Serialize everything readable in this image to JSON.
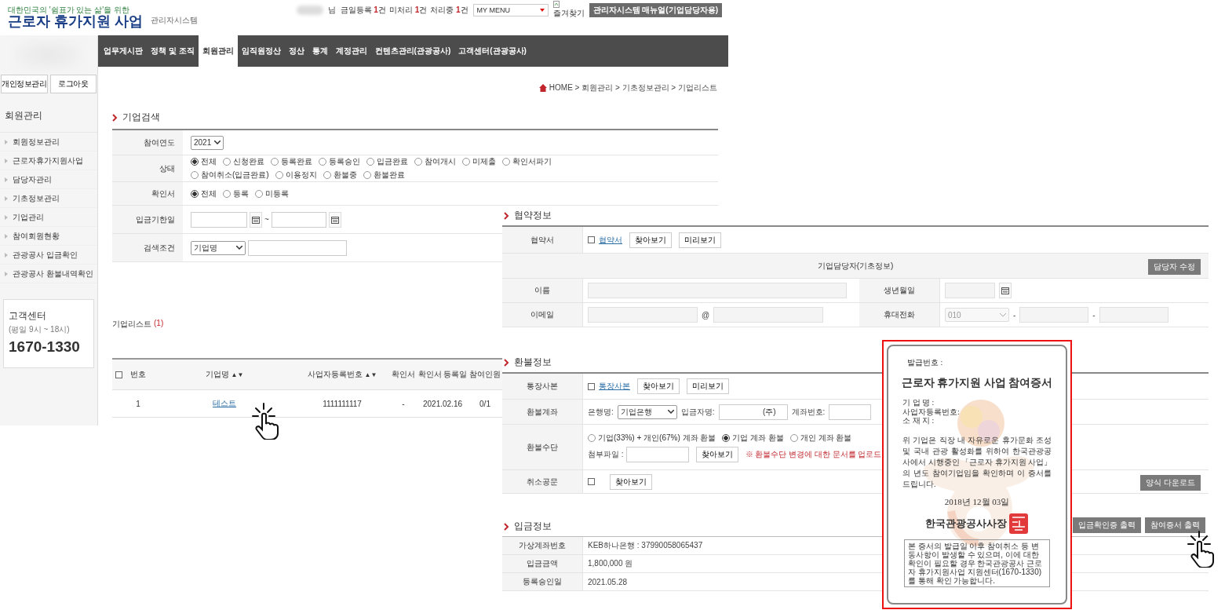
{
  "header": {
    "logo_tagline": "대한민국의 '쉼표가 있는 삶'을 위한",
    "logo_title": "근로자 휴가지원 사업",
    "system_label": "관리자시스템",
    "user_suffix": "님",
    "counts": [
      {
        "label": "금일등록",
        "count": "1",
        "unit": "건"
      },
      {
        "label": "미처리",
        "count": "1",
        "unit": "건"
      },
      {
        "label": "처리중",
        "count": "1",
        "unit": "건"
      }
    ],
    "my_menu": "MY MENU",
    "favorites": "즐겨찾기",
    "manual_button": "관리자시스템 매뉴얼(기업담당자용)"
  },
  "nav": [
    {
      "label": "업무게시판",
      "selected": false
    },
    {
      "label": "정책 및 조직",
      "selected": false
    },
    {
      "label": "회원관리",
      "selected": true
    },
    {
      "label": "임직원정산",
      "selected": false
    },
    {
      "label": "정산",
      "selected": false
    },
    {
      "label": "통계",
      "selected": false
    },
    {
      "label": "계정관리",
      "selected": false
    },
    {
      "label": "컨텐츠관리(관광공사)",
      "selected": false
    },
    {
      "label": "고객센터(관광공사)",
      "selected": false
    }
  ],
  "sidebar": {
    "buttons": [
      "개인정보관리",
      "로그아웃"
    ],
    "title": "회원관리",
    "items": [
      "회원정보관리",
      "근로자휴가지원사업",
      "담당자관리",
      "기초정보관리",
      "기업관리",
      "참여회원현황",
      "관광공사 입금확인",
      "관광공사 환불내역확인"
    ],
    "help": {
      "title": "고객센터",
      "hours": "(평일 9시 ~ 18시)",
      "phone": "1670-1330"
    }
  },
  "breadcrumb": "HOME > 회원관리 > 기초정보관리 > 기업리스트",
  "search": {
    "title": "기업검색",
    "year": {
      "label": "참여연도",
      "value": "2021"
    },
    "status": {
      "label": "상태",
      "options": [
        {
          "label": "전체",
          "selected": true
        },
        {
          "label": "신청완료",
          "selected": false
        },
        {
          "label": "등록완료",
          "selected": false
        },
        {
          "label": "등록승인",
          "selected": false
        },
        {
          "label": "입금완료",
          "selected": false
        },
        {
          "label": "참여개시",
          "selected": false
        },
        {
          "label": "미제출",
          "selected": false
        },
        {
          "label": "확인서파기",
          "selected": false
        },
        {
          "label": "참여취소(입금완료)",
          "selected": false
        },
        {
          "label": "이용정지",
          "selected": false
        },
        {
          "label": "환불중",
          "selected": false
        },
        {
          "label": "환불완료",
          "selected": false
        }
      ]
    },
    "confirm": {
      "label": "확인서",
      "options": [
        {
          "label": "전체",
          "selected": true
        },
        {
          "label": "등록",
          "selected": false
        },
        {
          "label": "미등록",
          "selected": false
        }
      ]
    },
    "deadline": {
      "label": "입금기한일",
      "separator": "~"
    },
    "condition": {
      "label": "검색조건",
      "value": "기업명"
    }
  },
  "company_list": {
    "title": "기업리스트",
    "count": "(1)",
    "header_checked": false,
    "columns": [
      {
        "label": "번호"
      },
      {
        "label": "기업명",
        "sort": "▲▼"
      },
      {
        "label": "사업자등록번호",
        "sort": "▲▼"
      },
      {
        "label": "확인서"
      },
      {
        "label": "확인서 등록일"
      },
      {
        "label": "참여인원"
      }
    ],
    "rows": [
      {
        "cells": [
          "1",
          "테스트",
          "1111111117",
          "-",
          "2021.02.16",
          "0/1"
        ]
      }
    ]
  },
  "agreement": {
    "title": "협약정보",
    "doc": {
      "label": "협약서",
      "checked": false,
      "link": "협약서",
      "buttons": [
        "찾아보기",
        "미리보기"
      ]
    },
    "contact_heading": "기업담당자(기초정보)",
    "edit_button": "담당자 수정",
    "name_label": "이름",
    "birth_label": "생년월일",
    "email_label": "이메일",
    "email_at": "@",
    "phone_label": "휴대전화",
    "phone_prefix": "010",
    "phone_dash": "-"
  },
  "refund": {
    "title": "환불정보",
    "passbook": {
      "label": "통장사본",
      "checked": false,
      "link": "통장사본",
      "buttons": [
        "찾아보기",
        "미리보기"
      ]
    },
    "account": {
      "label": "환불계좌",
      "bank_label": "은행명:",
      "bank": "기업은행",
      "depositor_label": "입금자명:",
      "depositor_suffix": "(주)",
      "account_label": "계좌번호:"
    },
    "method": {
      "label": "환불수단",
      "options": [
        {
          "label": "기업(33%) + 개인(67%) 계좌 환불",
          "selected": false
        },
        {
          "label": "기업 계좌 환불",
          "selected": true
        },
        {
          "label": "개인 계좌 환불",
          "selected": false
        }
      ],
      "file_label": "첨부파일 :",
      "file_button": "찾아보기",
      "notice": "※ 환불수단 변경에 대한 문서를 업로드"
    },
    "cancel": {
      "label": "취소공문",
      "checked": false,
      "button": "찾아보기"
    },
    "download_button": "양식 다운로드"
  },
  "payment": {
    "title": "입금정보",
    "buttons": [
      "입금확인증 출력",
      "참여증서 출력"
    ],
    "rows": [
      {
        "label": "가상계좌번호",
        "value": "KEB하나은행 : 37990058065437"
      },
      {
        "label": "입금금액",
        "value": "1,800,000 원"
      },
      {
        "label": "등록승인일",
        "value": "2021.05.28"
      }
    ]
  },
  "certificate": {
    "issue_no": "발급번호 :",
    "title": "근로자 휴가지원 사업 참여증서",
    "fields": [
      "기 업 명 :",
      "사업자등록번호:",
      "소 재 지 :"
    ],
    "body": "위 기업은 직장 내 자유로운 휴가문화 조성 및 국내 관광 활성화를 위하여 한국관광공사에서 시행중인 「근로자 휴가지원 사업」의 년도  참여기업임을 확인하며 이 증서를 드립니다.",
    "date": "2018년 12월 03일",
    "signer": "한국관광공사사장",
    "footnote": "본 증서의 발급일 이후 참여취소 등 변동사항이 발생할 수 있으며, 이에 대한 확인이 필요할 경우 한국관광공사 근로자 휴가지원사업 지원센터(1670-1330)를 통해 확인 가능합니다."
  }
}
